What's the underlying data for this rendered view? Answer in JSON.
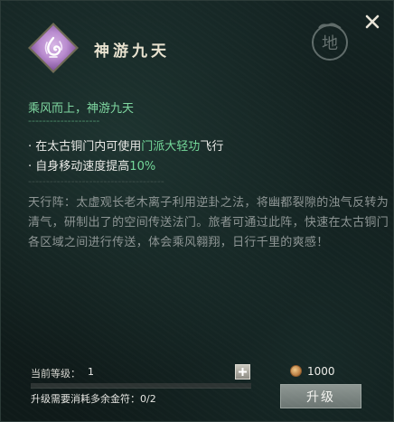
{
  "skill": {
    "title": "神游九天",
    "icon": "purple-wind-diamond-icon",
    "motto": "乘风而上，神游九天",
    "divider": "--------------------",
    "effects": [
      {
        "bullet": "·",
        "pre": "在太古铜门内可使用",
        "highlight": "门派大轻功",
        "post": "飞行"
      },
      {
        "bullet": "·",
        "pre": "自身移动速度提高",
        "highlight": "10%",
        "post": ""
      }
    ],
    "divider2": "--------------------------------------",
    "lore": "天行阵：太虚观长老木离子利用逆卦之法，将幽都裂隙的浊气反转为清气，研制出了的空间传送法门。旅者可通过此阵，快速在太古铜门各区域之间进行传送，体会乘风翱翔，日行千里的爽感！",
    "seal_glyph": "地"
  },
  "footer": {
    "level_label": "当前等级：",
    "level_value": "1",
    "progress": 0.0,
    "cost_label": "升级需要消耗多余金符：0/2",
    "coin_value": "1000",
    "upgrade_label": "升级"
  },
  "colors": {
    "accent_green": "#74d89a",
    "title_gold": "#e8e2cf",
    "lore_gray": "#8d9594"
  }
}
